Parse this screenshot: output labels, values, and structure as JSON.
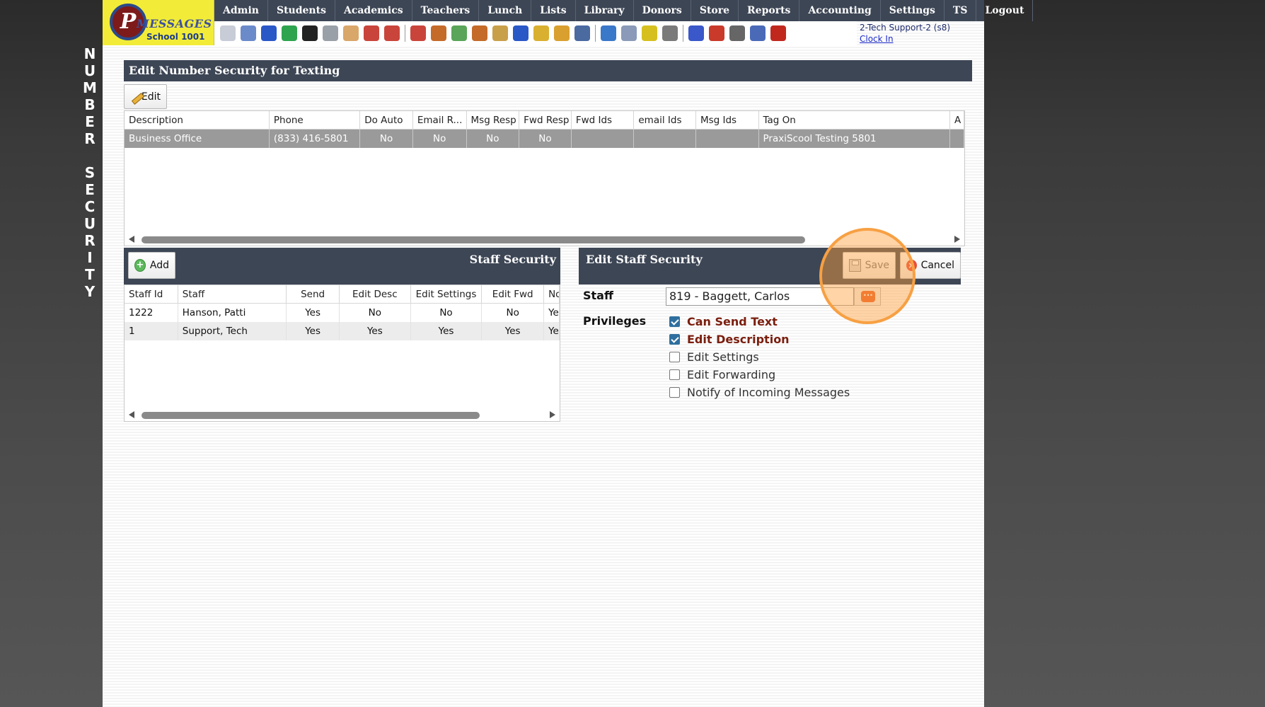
{
  "side_title": [
    "N",
    "U",
    "M",
    "B",
    "E",
    "R",
    " ",
    "S",
    "E",
    "C",
    "U",
    "R",
    "I",
    "T",
    "Y"
  ],
  "logo": {
    "letter": "P",
    "word": "MESSAGES",
    "school": "School 1001"
  },
  "nav": [
    "Admin",
    "Students",
    "Academics",
    "Teachers",
    "Lunch",
    "Lists",
    "Library",
    "Donors",
    "Store",
    "Reports",
    "Accounting",
    "Settings",
    "TS",
    "Logout"
  ],
  "toolbar_icons": [
    {
      "name": "search-icon",
      "color": "#c7ccd6"
    },
    {
      "name": "calendar-grid-icon",
      "color": "#6b8ac9"
    },
    {
      "name": "email-at-icon",
      "color": "#2a58c7"
    },
    {
      "name": "chat-icon",
      "color": "#2ea44f"
    },
    {
      "name": "phone-icon",
      "color": "#222222"
    },
    {
      "name": "speaker-icon",
      "color": "#9aa0a8"
    },
    {
      "name": "newsletter-icon",
      "color": "#d9a76a"
    },
    {
      "name": "calendar-icon",
      "color": "#c9453b"
    },
    {
      "name": "megaphone-icon",
      "color": "#c9453b"
    },
    {
      "name": "student-add-icon",
      "color": "#c9453b"
    },
    {
      "name": "teacher-icon",
      "color": "#c46b2a"
    },
    {
      "name": "money-icon",
      "color": "#5aa55a"
    },
    {
      "name": "group-icon",
      "color": "#c46b2a"
    },
    {
      "name": "lunch-icon",
      "color": "#c9a04a"
    },
    {
      "name": "book-icon",
      "color": "#2a58c7"
    },
    {
      "name": "bell-icon",
      "color": "#d9b030"
    },
    {
      "name": "store-icon",
      "color": "#d9a030"
    },
    {
      "name": "staff-icon",
      "color": "#4a6aa0"
    },
    {
      "name": "clock-icon",
      "color": "#3a78c9"
    },
    {
      "name": "report-icon",
      "color": "#8a9ab8"
    },
    {
      "name": "card-icon",
      "color": "#d6c020"
    },
    {
      "name": "printer-icon",
      "color": "#7a7a7a"
    },
    {
      "name": "ap-icon",
      "color": "#3a58c9"
    },
    {
      "name": "pdf-icon",
      "color": "#c93a2a"
    },
    {
      "name": "print-stack-icon",
      "color": "#666666"
    },
    {
      "name": "help-icon",
      "color": "#4a6ab8"
    },
    {
      "name": "power-icon",
      "color": "#c0281e"
    }
  ],
  "user": {
    "name": "2-Tech Support-2 (s8)",
    "clock_in": "Clock In"
  },
  "page_title": "Edit Number Security for Texting",
  "edit_button": "Edit",
  "numbers_grid": {
    "columns": [
      "Description",
      "Phone",
      "Do Auto",
      "Email R...",
      "Msg Resp",
      "Fwd Resp",
      "Fwd Ids",
      "email Ids",
      "Msg Ids",
      "Tag On",
      "A"
    ],
    "rows": [
      [
        "Business Office",
        "(833) 416-5801",
        "No",
        "No",
        "No",
        "No",
        "",
        "",
        "",
        "PraxiScool Testing 5801",
        ""
      ]
    ]
  },
  "staff_panel": {
    "title": "Staff Security",
    "add_button": "Add",
    "columns": [
      "Staff Id",
      "Staff",
      "Send",
      "Edit Desc",
      "Edit Settings",
      "Edit Fwd",
      "No"
    ],
    "rows": [
      [
        "1222",
        "Hanson, Patti",
        "Yes",
        "No",
        "No",
        "No",
        "Ye"
      ],
      [
        "1",
        "Support, Tech",
        "Yes",
        "Yes",
        "Yes",
        "Yes",
        "Ye"
      ]
    ]
  },
  "edit_panel": {
    "title": "Edit Staff Security",
    "save_button": "Save",
    "cancel_button": "Cancel",
    "staff_label": "Staff",
    "staff_value": "819 - Baggett, Carlos",
    "privileges_label": "Privileges",
    "privileges": [
      {
        "label": "Can Send Text",
        "checked": true
      },
      {
        "label": "Edit Description",
        "checked": true
      },
      {
        "label": "Edit Settings",
        "checked": false
      },
      {
        "label": "Edit Forwarding",
        "checked": false
      },
      {
        "label": "Notify of Incoming Messages",
        "checked": false
      }
    ]
  },
  "colors": {
    "header_bg": "#3d4655",
    "logo_bg": "#f2ec38",
    "selected_row": "#9a9a9a",
    "highlight": "#f7a043"
  }
}
